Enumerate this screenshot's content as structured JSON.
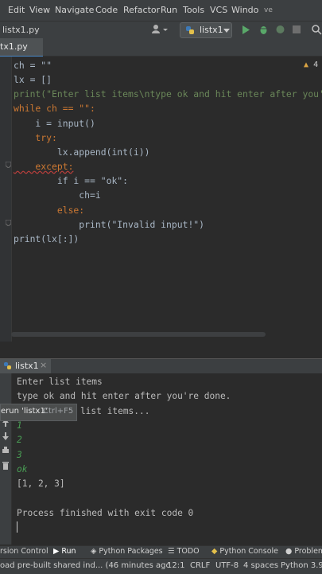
{
  "menubar": {
    "items": [
      "Edit",
      "View",
      "Navigate",
      "Code",
      "Refactor",
      "Run",
      "Tools",
      "VCS",
      "Windo",
      "ve"
    ]
  },
  "navbar": {
    "breadcrumb": "listx1.py",
    "run_config": "listx1"
  },
  "tabs": {
    "file": "tx1.py"
  },
  "editor": {
    "warning_count": "4",
    "lines": [
      "ch = \"\"",
      "lx = []",
      "print(\"Enter list items\\ntype ok and hit enter after you're",
      "while ch == \"\":",
      "    i = input()",
      "    try:",
      "        lx.append(int(i))",
      "    except:",
      "        if i == \"ok\":",
      "            ch=i",
      "        else:",
      "            print(\"Invalid input!\")",
      "print(lx[:])"
    ]
  },
  "run_panel": {
    "tab_label": "listx1",
    "tooltip_action": "erun 'listx1'",
    "tooltip_shortcut": "Ctrl+F5",
    "console": [
      {
        "text": "Enter list items",
        "type": "out"
      },
      {
        "text": "type ok and hit enter after you're done.",
        "type": "out"
      },
      {
        "text": "ing list items...",
        "type": "out"
      },
      {
        "text": "1",
        "type": "in"
      },
      {
        "text": "2",
        "type": "in"
      },
      {
        "text": "3",
        "type": "in"
      },
      {
        "text": "ok",
        "type": "in"
      },
      {
        "text": "[1, 2, 3]",
        "type": "out"
      },
      {
        "text": "",
        "type": "out"
      },
      {
        "text": "Process finished with exit code 0",
        "type": "out"
      }
    ]
  },
  "bottom_tabs": [
    "rsion Control",
    "Run",
    "Python Packages",
    "TODO",
    "Python Console",
    "Problem"
  ],
  "statusbar": {
    "message": "oad pre-built shared ind... (46 minutes agc",
    "position": "12:1",
    "line_sep": "CRLF",
    "encoding": "UTF-8",
    "indent": "4 spaces",
    "interpreter": "Python 3.9 ("
  }
}
